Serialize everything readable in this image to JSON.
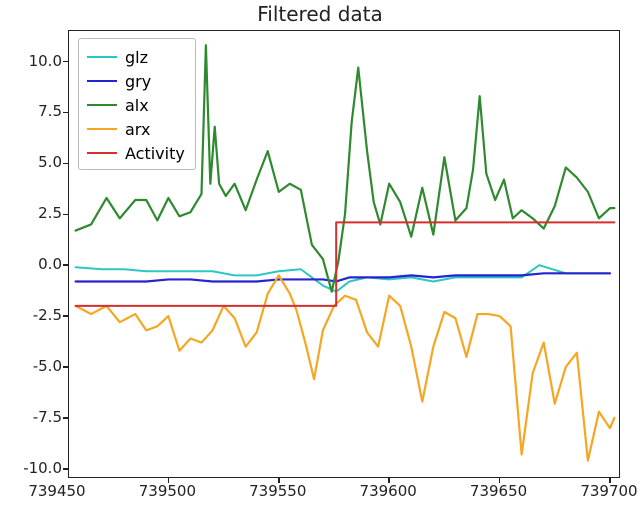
{
  "chart_data": {
    "type": "line",
    "title": "Filtered data",
    "xlabel": "",
    "ylabel": "",
    "xlim": [
      739455,
      739705
    ],
    "ylim": [
      -10.5,
      11.5
    ],
    "xticks": [
      739450,
      739500,
      739550,
      739600,
      739650,
      739700
    ],
    "yticks": [
      -10.0,
      -7.5,
      -5.0,
      -2.5,
      0.0,
      2.5,
      5.0,
      7.5,
      10.0
    ],
    "legend_position": "upper-left",
    "series": [
      {
        "name": "glz",
        "color": "#2ec5c5",
        "x": [
          739458,
          739470,
          739480,
          739490,
          739500,
          739510,
          739520,
          739530,
          739540,
          739550,
          739560,
          739570,
          739576,
          739582,
          739590,
          739600,
          739610,
          739620,
          739630,
          739640,
          739650,
          739660,
          739668,
          739680,
          739690,
          739700
        ],
        "y": [
          -0.1,
          -0.2,
          -0.2,
          -0.3,
          -0.3,
          -0.3,
          -0.3,
          -0.5,
          -0.5,
          -0.3,
          -0.2,
          -1.0,
          -1.3,
          -0.8,
          -0.6,
          -0.7,
          -0.6,
          -0.8,
          -0.6,
          -0.6,
          -0.6,
          -0.6,
          0.0,
          -0.4,
          -0.4,
          -0.4
        ]
      },
      {
        "name": "gry",
        "color": "#2424d0",
        "x": [
          739458,
          739470,
          739480,
          739490,
          739500,
          739510,
          739520,
          739530,
          739540,
          739550,
          739560,
          739570,
          739576,
          739582,
          739590,
          739600,
          739610,
          739620,
          739630,
          739640,
          739650,
          739660,
          739670,
          739680,
          739690,
          739700
        ],
        "y": [
          -0.8,
          -0.8,
          -0.8,
          -0.8,
          -0.7,
          -0.7,
          -0.8,
          -0.8,
          -0.8,
          -0.7,
          -0.7,
          -0.7,
          -0.8,
          -0.6,
          -0.6,
          -0.6,
          -0.5,
          -0.6,
          -0.5,
          -0.5,
          -0.5,
          -0.5,
          -0.4,
          -0.4,
          -0.4,
          -0.4
        ]
      },
      {
        "name": "alx",
        "color": "#2f8a2f",
        "x": [
          739458,
          739465,
          739472,
          739478,
          739485,
          739490,
          739495,
          739500,
          739505,
          739510,
          739515,
          739517,
          739519,
          739521,
          739523,
          739526,
          739530,
          739535,
          739540,
          739545,
          739550,
          739555,
          739560,
          739565,
          739570,
          739574,
          739577,
          739580,
          739583,
          739586,
          739590,
          739593,
          739596,
          739600,
          739605,
          739610,
          739615,
          739620,
          739625,
          739630,
          739635,
          739638,
          739641,
          739644,
          739648,
          739652,
          739656,
          739660,
          739665,
          739670,
          739675,
          739680,
          739685,
          739690,
          739695,
          739700,
          739702
        ],
        "y": [
          1.7,
          2.0,
          3.3,
          2.3,
          3.2,
          3.2,
          2.2,
          3.3,
          2.4,
          2.6,
          3.5,
          10.8,
          4.0,
          6.8,
          4.0,
          3.4,
          4.0,
          2.7,
          4.2,
          5.6,
          3.6,
          4.0,
          3.7,
          1.0,
          0.3,
          -1.3,
          0.2,
          2.5,
          7.0,
          9.7,
          5.6,
          3.1,
          2.0,
          4.0,
          3.1,
          1.4,
          3.8,
          1.5,
          5.3,
          2.2,
          2.8,
          4.7,
          8.3,
          4.5,
          3.2,
          4.2,
          2.3,
          2.7,
          2.3,
          1.8,
          2.9,
          4.8,
          4.3,
          3.6,
          2.3,
          2.8,
          2.8
        ]
      },
      {
        "name": "arx",
        "color": "#f5a623",
        "x": [
          739458,
          739465,
          739472,
          739478,
          739485,
          739490,
          739495,
          739500,
          739505,
          739510,
          739515,
          739520,
          739525,
          739530,
          739535,
          739540,
          739545,
          739550,
          739555,
          739558,
          739562,
          739566,
          739570,
          739575,
          739580,
          739585,
          739590,
          739595,
          739600,
          739605,
          739610,
          739615,
          739620,
          739625,
          739630,
          739635,
          739640,
          739645,
          739650,
          739655,
          739660,
          739665,
          739670,
          739675,
          739680,
          739685,
          739690,
          739695,
          739700,
          739702
        ],
        "y": [
          -2.0,
          -2.4,
          -2.0,
          -2.8,
          -2.4,
          -3.2,
          -3.0,
          -2.5,
          -4.2,
          -3.6,
          -3.8,
          -3.2,
          -2.0,
          -2.6,
          -4.0,
          -3.3,
          -1.4,
          -0.5,
          -1.4,
          -2.2,
          -3.8,
          -5.6,
          -3.2,
          -2.0,
          -1.5,
          -1.7,
          -3.3,
          -4.0,
          -1.5,
          -2.0,
          -4.0,
          -6.7,
          -4.0,
          -2.3,
          -2.6,
          -4.5,
          -2.4,
          -2.4,
          -2.5,
          -3.0,
          -9.3,
          -5.3,
          -3.8,
          -6.8,
          -5.0,
          -4.3,
          -9.6,
          -7.2,
          -8.0,
          -7.5
        ]
      },
      {
        "name": "Activity",
        "color": "#d62f2f",
        "x": [
          739458,
          739576,
          739576,
          739702
        ],
        "y": [
          -2.0,
          -2.0,
          2.1,
          2.1
        ]
      }
    ]
  }
}
